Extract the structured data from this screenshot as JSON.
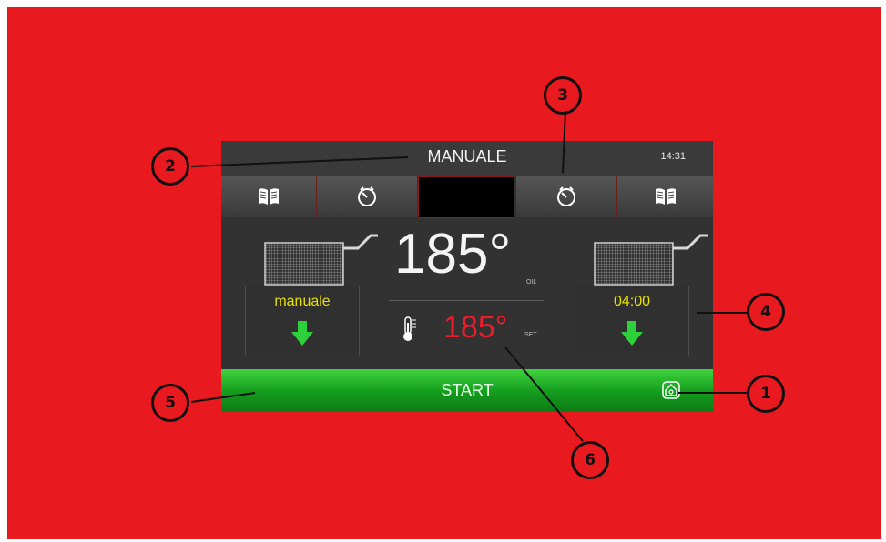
{
  "header": {
    "mode": "MANUALE",
    "clock": "14:31"
  },
  "toolbar": {
    "items": [
      {
        "icon": "book-icon"
      },
      {
        "icon": "timer-icon"
      },
      {
        "icon": "display-blank"
      },
      {
        "icon": "timer-icon"
      },
      {
        "icon": "book-icon"
      }
    ]
  },
  "left_basket": {
    "label": "manuale",
    "icon": "down-arrow-icon"
  },
  "right_basket": {
    "label": "04:00",
    "icon": "down-arrow-icon"
  },
  "oil": {
    "temp": "185°",
    "unit_label": "OIL"
  },
  "set": {
    "temp": "185°",
    "unit_label": "SET"
  },
  "start_bar": {
    "label": "START",
    "icon": "home-icon"
  },
  "callouts": [
    "1",
    "2",
    "3",
    "4",
    "5",
    "6"
  ],
  "colors": {
    "background": "#e8191f",
    "panel": "#323232",
    "label_yellow": "#e7e000",
    "set_red": "#ec1d2a",
    "start_green": "#149b1d"
  }
}
